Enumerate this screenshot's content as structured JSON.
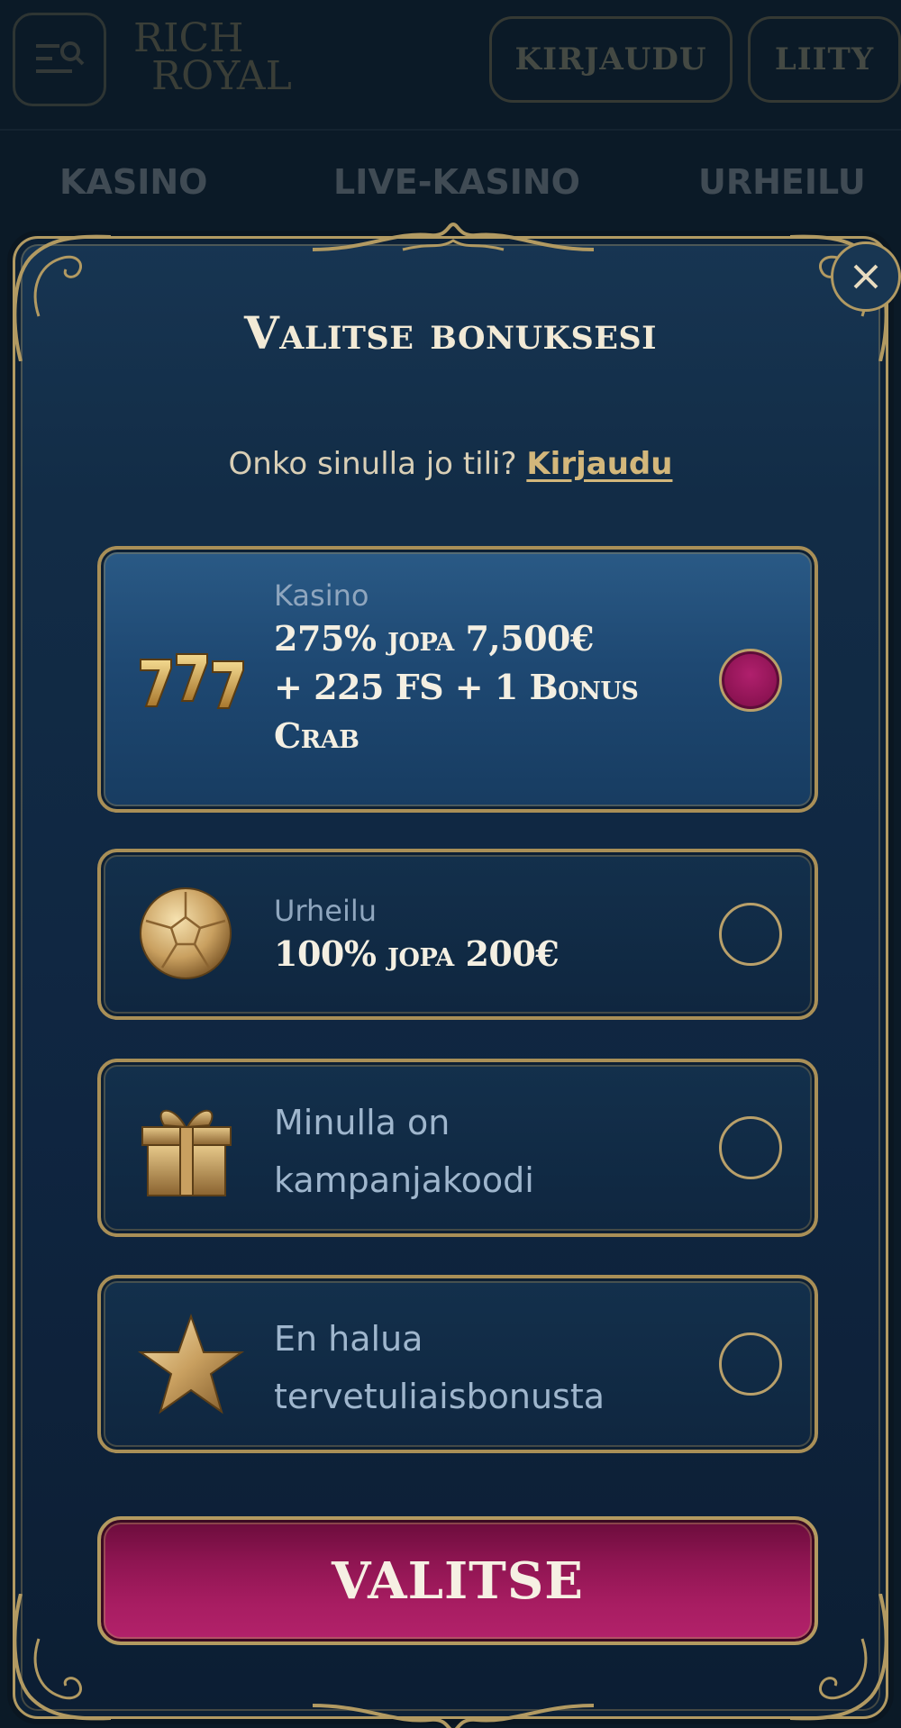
{
  "header": {
    "logo_line1": "RICH",
    "logo_line2": "ROYAL",
    "login_label": "KIRJAUDU",
    "join_label": "LIITY"
  },
  "nav": {
    "items": [
      "KASINO",
      "LIVE-KASINO",
      "URHEILU"
    ]
  },
  "modal": {
    "title": "Valitse bonuksesi",
    "login_prompt": "Onko sinulla jo tili?",
    "login_link": "Kirjaudu",
    "options": [
      {
        "category": "Kasino",
        "offer_line1": "275% jopa 7,500€",
        "offer_line2": "+ 225 FS + 1 Bonus",
        "offer_line3": "Crab",
        "icon": "slot-777-icon",
        "selected": true
      },
      {
        "category": "Urheilu",
        "offer_line1": "100% jopa 200€",
        "icon": "football-icon",
        "selected": false
      },
      {
        "label_line1": "Minulla on",
        "label_line2": "kampanjakoodi",
        "icon": "gift-icon",
        "selected": false
      },
      {
        "label_line1": "En halua",
        "label_line2": "tervetuliaisbonusta",
        "icon": "star-icon",
        "selected": false
      }
    ],
    "submit_label": "VALITSE"
  },
  "colors": {
    "background": "#0b1a27",
    "modal": "#122c46",
    "gold": "#b29a62",
    "accent": "#a81d62"
  }
}
